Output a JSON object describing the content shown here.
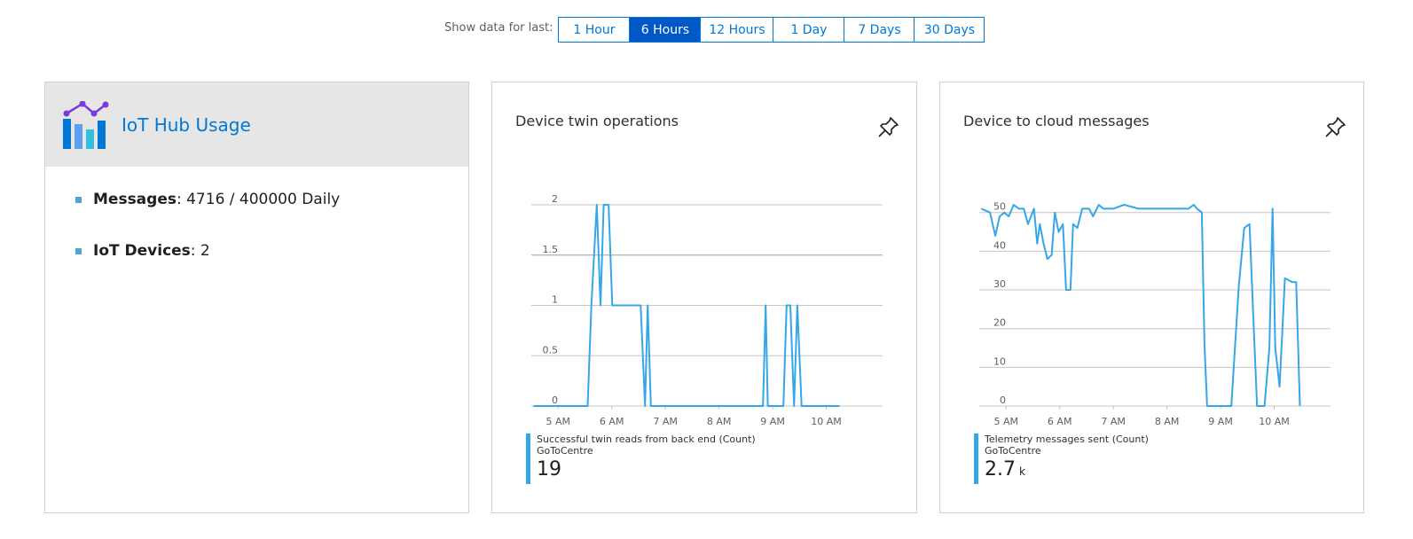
{
  "range": {
    "label": "Show data for last:",
    "options": [
      "1 Hour",
      "6 Hours",
      "12 Hours",
      "1 Day",
      "7 Days",
      "30 Days"
    ],
    "selected": "6 Hours"
  },
  "usage": {
    "title": "IoT Hub Usage",
    "items": [
      {
        "key": "Messages",
        "value": ": 4716 / 400000 Daily"
      },
      {
        "key": "IoT Devices",
        "value": ": 2"
      }
    ]
  },
  "colors": {
    "accent": "#0078d4",
    "selected": "#0058c7",
    "series": "#35a7e8",
    "header_bg": "#e6e6e6"
  },
  "icons": {
    "usage": "chart-icon",
    "pin": "pin-icon"
  },
  "chart_data": [
    {
      "type": "line",
      "title": "Device twin operations",
      "x_ticks": [
        "5 AM",
        "6 AM",
        "7 AM",
        "8 AM",
        "9 AM",
        "10 AM"
      ],
      "y_ticks": [
        "0",
        "0.5",
        "1",
        "1.5",
        "2"
      ],
      "ylim": [
        0,
        2
      ],
      "xlim": [
        4.5,
        11.05
      ],
      "grid": true,
      "series": [
        {
          "name": "Successful twin reads from back end (Count)",
          "source": "GoToCentre",
          "total": "19",
          "unit": "",
          "x": [
            4.54,
            5.55,
            5.62,
            5.72,
            5.79,
            5.85,
            5.94,
            6.01,
            6.45,
            6.54,
            6.62,
            6.67,
            6.73,
            7.0,
            8.0,
            8.82,
            8.87,
            8.91,
            8.97,
            9.2,
            9.26,
            9.33,
            9.4,
            9.46,
            9.54,
            9.62,
            9.65,
            9.7,
            10.0,
            10.25
          ],
          "y": [
            0,
            0,
            1,
            2,
            1,
            2,
            2,
            1,
            1,
            1,
            0,
            1,
            0,
            0,
            0,
            0,
            1,
            0,
            0,
            0,
            1,
            1,
            0,
            1,
            0,
            0,
            0,
            0,
            0,
            0
          ]
        }
      ]
    },
    {
      "type": "line",
      "title": "Device to cloud messages",
      "x_ticks": [
        "5 AM",
        "6 AM",
        "7 AM",
        "8 AM",
        "9 AM",
        "10 AM"
      ],
      "y_ticks": [
        "0",
        "10",
        "20",
        "30",
        "40",
        "50"
      ],
      "ylim": [
        0,
        52
      ],
      "xlim": [
        4.5,
        11.05
      ],
      "grid": true,
      "series": [
        {
          "name": "Telemetry messages sent (Count)",
          "source": "GoToCentre",
          "total": "2.7",
          "unit": "k",
          "x": [
            4.54,
            4.7,
            4.8,
            4.88,
            4.97,
            5.05,
            5.14,
            5.24,
            5.33,
            5.41,
            5.52,
            5.58,
            5.63,
            5.7,
            5.77,
            5.85,
            5.91,
            5.98,
            6.06,
            6.12,
            6.2,
            6.25,
            6.33,
            6.42,
            6.55,
            6.62,
            6.73,
            6.81,
            6.94,
            7.0,
            7.2,
            7.47,
            7.57,
            7.67,
            8.0,
            8.4,
            8.5,
            8.56,
            8.65,
            8.7,
            8.75,
            8.85,
            9.0,
            9.2,
            9.34,
            9.44,
            9.54,
            9.62,
            9.68,
            9.73,
            9.82,
            9.91,
            9.97,
            10.02,
            10.1,
            10.2,
            10.34,
            10.41,
            10.48
          ],
          "y": [
            51,
            50,
            44,
            49,
            50,
            49,
            52,
            51,
            51,
            47,
            51,
            42,
            47,
            42,
            38,
            39,
            50,
            45,
            47,
            30,
            30,
            47,
            46,
            51,
            51,
            49,
            52,
            51,
            51,
            51,
            52,
            51,
            51,
            51,
            51,
            51,
            52,
            51,
            50,
            16,
            0,
            0,
            0,
            0,
            31,
            46,
            47,
            20,
            0,
            0,
            0,
            15,
            51,
            15,
            5,
            33,
            32,
            32,
            0
          ]
        }
      ]
    }
  ]
}
